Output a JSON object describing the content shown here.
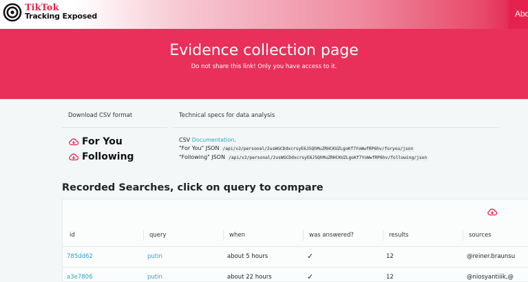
{
  "header": {
    "brand_top": "TikTok",
    "brand_bottom": "Tracking Exposed",
    "about_label": "About"
  },
  "hero": {
    "title": "Evidence collection page",
    "subtitle": "Do not share this link! Only you have access to it."
  },
  "downloads": {
    "heading": "Download CSV format",
    "items": [
      {
        "label": "For You",
        "icon": "cloud-download-icon"
      },
      {
        "label": "Following",
        "icon": "cloud-download-icon"
      }
    ]
  },
  "specs": {
    "heading": "Technical specs for data analysis",
    "csv_prefix": "CSV",
    "csv_link": "Documentation",
    "csv_suffix": ".",
    "foryou_label": "\"For You\" JSON",
    "foryou_path": "/api/v2/personal/2usWGCDdxcrsyE6J5QhMuZRHCKUZLgoKf7YoWwfRP6hv/foryou/json",
    "following_label": "\"Following\" JSON",
    "following_path": "/api/v2/personal/2usWGCDdxcrsyE6J5QhMuZRHCKUZLgoKf7YoWwfRP6hv/following/json"
  },
  "searches": {
    "title": "Recorded Searches, click on query to compare",
    "columns": [
      "id",
      "query",
      "when",
      "was answered?",
      "results",
      "sources"
    ],
    "rows": [
      {
        "id": "785dd62",
        "query": "putin",
        "when": "about 5 hours",
        "answered": "✓",
        "results": "12",
        "sources": "@reiner.braunsu"
      },
      {
        "id": "a3e7806",
        "query": "putin",
        "when": "about 22 hours",
        "answered": "✓",
        "results": "12",
        "sources": "@niosyantiiik,@"
      }
    ]
  },
  "colors": {
    "brand": "#e5224e",
    "hero": "#e8305a",
    "link": "#2aa3c8"
  }
}
